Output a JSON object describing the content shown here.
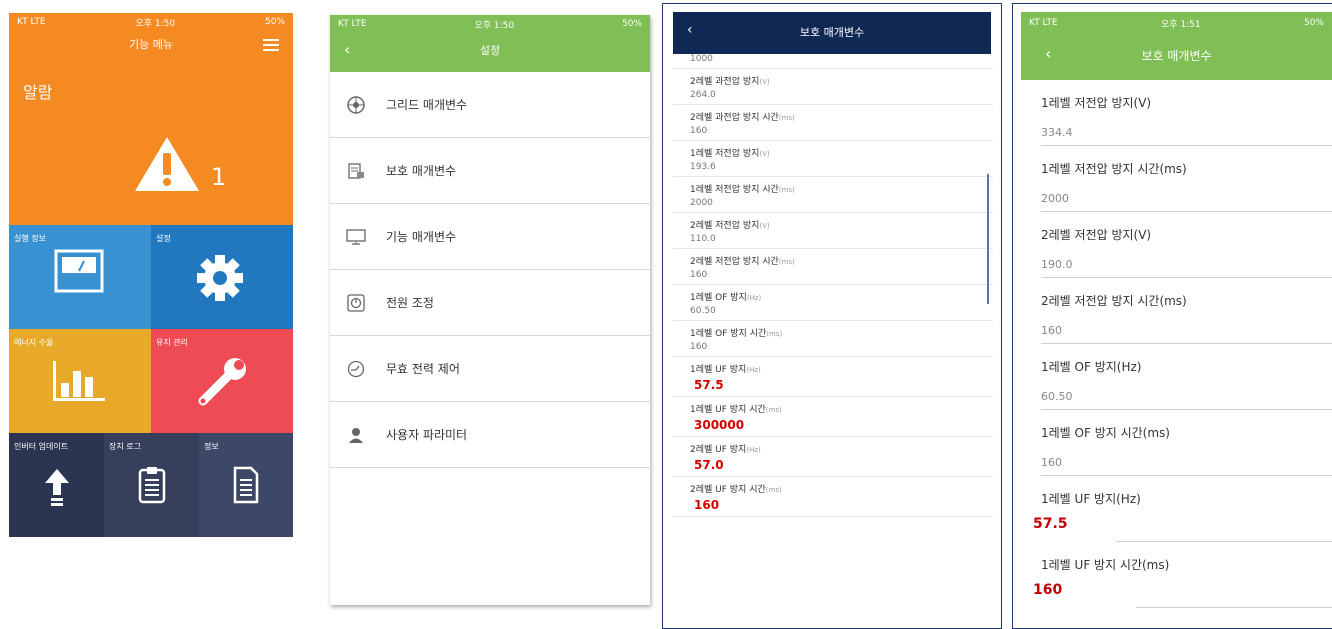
{
  "phone1": {
    "status": {
      "carrier": "KT LTE",
      "time": "오후 1:50",
      "battery": "50%"
    },
    "header_title": "기능 메뉴",
    "alarm": {
      "label": "알람",
      "count": "1"
    },
    "tiles": [
      {
        "label": "실행 정보",
        "icon": "meter-icon",
        "color": "#3a91d2"
      },
      {
        "label": "설정",
        "icon": "gear-icon",
        "color": "#2178bf"
      },
      {
        "label": "에너지 수율",
        "icon": "bar-chart-icon",
        "color": "#e8a92b"
      },
      {
        "label": "유지 관리",
        "icon": "wrench-icon",
        "color": "#ee4b55"
      },
      {
        "label": "인버터 업데이트",
        "icon": "upload-arrow-icon",
        "color": "#2b3551"
      },
      {
        "label": "장치 로그",
        "icon": "clipboard-icon",
        "color": "#353f5c"
      },
      {
        "label": "정보",
        "icon": "document-icon",
        "color": "#3d4866"
      }
    ]
  },
  "phone2": {
    "status": {
      "carrier": "KT LTE",
      "time": "오후 1:50",
      "battery": "50%"
    },
    "title": "설정",
    "items": [
      {
        "label": "그리드 매개변수",
        "icon": "grid-icon"
      },
      {
        "label": "보호 매개변수",
        "icon": "protection-icon"
      },
      {
        "label": "기능 매개변수",
        "icon": "monitor-icon"
      },
      {
        "label": "전원 조정",
        "icon": "power-adjust-icon"
      },
      {
        "label": "무효 전력 제어",
        "icon": "reactive-power-icon"
      },
      {
        "label": "사용자 파라미터",
        "icon": "user-icon"
      }
    ]
  },
  "phone3": {
    "title": "보호 매개변수",
    "top_value": "1000",
    "rows": [
      {
        "label": "2레벨 과전압 방지",
        "unit": "(V)",
        "value": "264.0",
        "highlight": false
      },
      {
        "label": "2레벨 과전압 방지 시간",
        "unit": "(ms)",
        "value": "160",
        "highlight": false
      },
      {
        "label": "1레벨 저전압 방지",
        "unit": "(V)",
        "value": "193.6",
        "highlight": false
      },
      {
        "label": "1레벨 저전압 방지 시간",
        "unit": "(ms)",
        "value": "2000",
        "highlight": false
      },
      {
        "label": "2레벨 저전압 방지",
        "unit": "(V)",
        "value": "110.0",
        "highlight": false
      },
      {
        "label": "2레벨 저전압 방지 시간",
        "unit": "(ms)",
        "value": "160",
        "highlight": false
      },
      {
        "label": "1레벨 OF 방지",
        "unit": "(Hz)",
        "value": "60.50",
        "highlight": false
      },
      {
        "label": "1레벨 OF 방지 시간",
        "unit": "(ms)",
        "value": "160",
        "highlight": false
      },
      {
        "label": "1레벨 UF 방지",
        "unit": "(Hz)",
        "value": "57.5",
        "highlight": true
      },
      {
        "label": "1레벨 UF 방지 시간",
        "unit": "(ms)",
        "value": "300000",
        "highlight": true
      },
      {
        "label": "2레벨 UF 방지",
        "unit": "(Hz)",
        "value": "57.0",
        "highlight": true
      },
      {
        "label": "2레벨 UF 방지 시간",
        "unit": "(ms)",
        "value": "160",
        "highlight": true
      }
    ]
  },
  "phone4": {
    "status": {
      "carrier": "KT LTE",
      "time": "오후 1:51",
      "battery": "50%"
    },
    "title": "보호 매개변수",
    "rows": [
      {
        "label": "1레벨 저전압 방지(V)",
        "value": "334.4",
        "highlight": false
      },
      {
        "label": "1레벨 저전압 방지 시간(ms)",
        "value": "2000",
        "highlight": false
      },
      {
        "label": "2레벨 저전압 방지(V)",
        "value": "190.0",
        "highlight": false
      },
      {
        "label": "2레벨 저전압 방지 시간(ms)",
        "value": "160",
        "highlight": false
      },
      {
        "label": "1레벨 OF 방지(Hz)",
        "value": "60.50",
        "highlight": false
      },
      {
        "label": "1레벨 OF 방지 시간(ms)",
        "value": "160",
        "highlight": false
      },
      {
        "label": "1레벨 UF 방지(Hz)",
        "value": "57.5",
        "highlight": true
      },
      {
        "label": "1레벨 UF 방지 시간(ms)",
        "value": "160",
        "highlight": true
      }
    ]
  }
}
